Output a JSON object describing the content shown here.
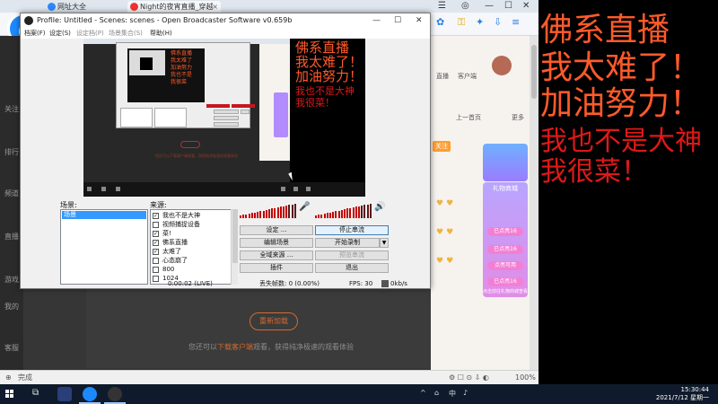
{
  "browser": {
    "tabs": [
      {
        "label": "网址大全"
      },
      {
        "label": "Night的夜宵直播_穿越"
      }
    ],
    "status_text": "完成",
    "zoom": "100%",
    "left_nav": [
      "关注",
      "排行",
      "频道",
      "直播",
      "游戏",
      "我的",
      "客服"
    ],
    "right_panel": {
      "labels": [
        "直播",
        "客户端",
        "上一首页",
        "更多"
      ],
      "follow": "关注",
      "gift_title": "礼物商城",
      "gift_items": [
        "已点亮16",
        "已点亮16",
        "点亮可用",
        "已点亮16"
      ],
      "gift_footer": "点击前往礼物商城查看"
    },
    "reload_button": "重新加载",
    "tip_prefix": "您还可以",
    "tip_link": "下载客户端",
    "tip_suffix": "观看，获得纯净极速的观看体验"
  },
  "overlay_text": {
    "white_lines": [
      "佛系直播",
      "我太难了！",
      "加油努力！"
    ],
    "red_lines": [
      "我也不是大神",
      "我很菜！"
    ]
  },
  "obs": {
    "title": "Profile: Untitled - Scenes: scenes - Open Broadcaster Software v0.659b",
    "menu": [
      {
        "label": "档案(F)",
        "dim": false
      },
      {
        "label": "设定(S)",
        "dim": false
      },
      {
        "label": "设定档(P)",
        "dim": true
      },
      {
        "label": "场景集合(S)",
        "dim": true
      },
      {
        "label": "帮助(H)",
        "dim": false
      }
    ],
    "scenes_label": "场景:",
    "sources_label": "来源:",
    "scenes": [
      "场景"
    ],
    "sources": [
      {
        "label": "我也不是大神",
        "checked": true
      },
      {
        "label": "视频捕捉设备",
        "checked": false
      },
      {
        "label": "菜!",
        "checked": true
      },
      {
        "label": "佛系直播",
        "checked": true
      },
      {
        "label": "太难了",
        "checked": true
      },
      {
        "label": "心态崩了",
        "checked": false
      },
      {
        "label": "800",
        "checked": false
      },
      {
        "label": "1024",
        "checked": false
      }
    ],
    "buttons": {
      "settings": "设定 ...",
      "stop_stream": "停止串流",
      "edit_scene": "编辑场景",
      "start_record": "开始录制",
      "global_sources": "全域来源 ...",
      "preview_stream": "预览串流",
      "plugins": "插件",
      "exit": "退出"
    },
    "status": {
      "time": "0:00:02 (LIVE)",
      "dropped": "丢失帧数: 0 (0.00%)",
      "fps": "FPS: 30",
      "bitrate": "0kb/s"
    },
    "mic_level": 0.8,
    "desktop_level": 0.75
  },
  "taskbar": {
    "tray": [
      "^",
      "中"
    ],
    "time": "15:30:44",
    "date": "2021/7/12 星期一"
  }
}
